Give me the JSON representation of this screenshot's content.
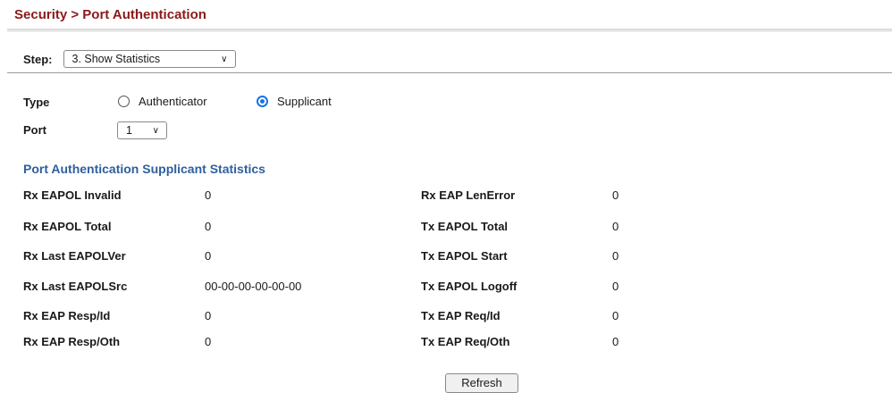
{
  "header": {
    "title": "Security > Port Authentication"
  },
  "step": {
    "label": "Step:",
    "selected": "3. Show Statistics"
  },
  "form": {
    "type_label": "Type",
    "type_options": [
      {
        "label": "Authenticator",
        "checked": false
      },
      {
        "label": "Supplicant",
        "checked": true
      }
    ],
    "port_label": "Port",
    "port_selected": "1"
  },
  "stats": {
    "title": "Port Authentication Supplicant Statistics",
    "left": [
      {
        "label": "Rx EAPOL Invalid",
        "value": "0"
      },
      {
        "label": "Rx EAPOL Total",
        "value": "0"
      },
      {
        "label": "Rx Last EAPOLVer",
        "value": "0"
      },
      {
        "label": "Rx Last EAPOLSrc",
        "value": "00-00-00-00-00-00"
      },
      {
        "label": "Rx EAP Resp/Id",
        "value": "0"
      },
      {
        "label": "Rx EAP Resp/Oth",
        "value": "0"
      }
    ],
    "right": [
      {
        "label": "Rx EAP LenError",
        "value": "0"
      },
      {
        "label": "Tx EAPOL Total",
        "value": "0"
      },
      {
        "label": "Tx EAPOL Start",
        "value": "0"
      },
      {
        "label": "Tx EAPOL Logoff",
        "value": "0"
      },
      {
        "label": "Tx EAP Req/Id",
        "value": "0"
      },
      {
        "label": "Tx EAP Req/Oth",
        "value": "0"
      }
    ]
  },
  "actions": {
    "refresh_label": "Refresh"
  },
  "colors": {
    "title": "#8b1a1a",
    "section_title": "#2f5f9e",
    "radio_accent": "#1a73e8"
  }
}
